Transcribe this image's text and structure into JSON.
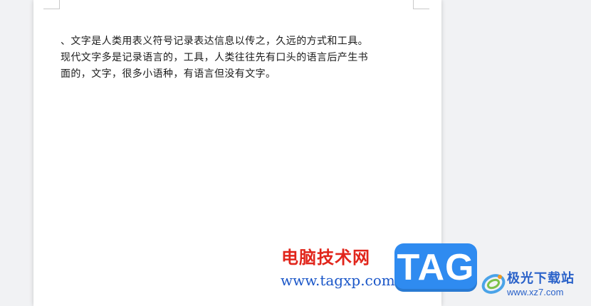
{
  "document": {
    "lines": [
      "、文字是人类用表义符号记录表达信息以传之，久远的方式和工具。",
      "现代文字多是记录语言的，工具，人类往往先有口头的语言后产生书",
      "面的，文字，很多小语种，有语言但没有文字。"
    ]
  },
  "watermarks": {
    "tag_site": {
      "title": "电脑技术网",
      "url": "www.tagxp.com",
      "badge": "TAG",
      "title_color": "#e1251b",
      "url_color": "#1a56c8",
      "badge_color": "#2f8bf0"
    },
    "xz_site": {
      "name": "极光下载站",
      "url": "www.xz7.com",
      "logo_icon": "aurora-logo-icon",
      "color": "#2a62c9"
    }
  },
  "colors": {
    "workspace_bg": "#f1f2f4",
    "page_bg": "#ffffff",
    "text": "#1a1a1a"
  }
}
